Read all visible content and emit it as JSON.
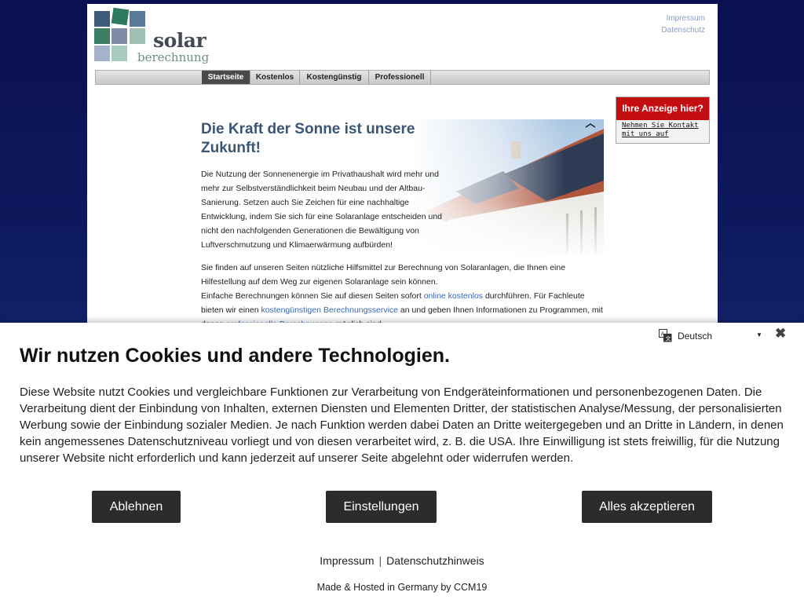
{
  "colors": {
    "nav_active": "#4a4a4a",
    "ad_red": "#c40d10",
    "headline": "#3b5674",
    "link": "#3a68b4",
    "button": "#2c2c2c"
  },
  "logo": {
    "word1": "solar",
    "word2": "berechnung"
  },
  "toplinks": [
    "Impressum",
    "Datenschutz"
  ],
  "nav": [
    "Startseite",
    "Kostenlos",
    "Kostengünstig",
    "Professionell"
  ],
  "ad": {
    "title": "Ihre Anzeige hier?",
    "link_line1": "Nehmen Sie Kontakt",
    "link_line2": "mit uns auf"
  },
  "content": {
    "headline": "Die Kraft der Sonne ist unsere Zukunft!",
    "para1": "Die Nutzung der Sonnenenergie im Privathaushalt wird mehr und mehr zur Selbstverständlichkeit beim Neubau und der Altbau-Sanierung. Setzen auch Sie Zeichen für eine nachhaltige Entwicklung, indem Sie sich für eine Solaranlage entscheiden und nicht den nachfolgenden Generationen die Bewältigung von Luftverschmutzung und Klimaerwärmung aufbürden!",
    "para2": "Sie finden auf unseren Seiten nützliche Hilfsmittel zur Berechnung von Solaranlagen, die Ihnen eine Hilfestellung auf dem Weg zur eigenen Solaranlage sein können.",
    "para3_a": "Einfache Berechnungen können Sie auf diesen Seiten sofort",
    "para3_link1": "online kostenlos",
    "para3_b": "durchführen. Für Fachleute bieten wir einen",
    "para3_link2": "kostengünstigen Berechnungsservice",
    "para3_c": "an und geben Ihnen Informationen zu Programmen, mit denen",
    "para3_link3": "professionelle Berechnungen",
    "para3_d": "möglich sind."
  },
  "cookie": {
    "language": "Deutsch",
    "title": "Wir nutzen Cookies und andere Technologien.",
    "text": "Diese Website nutzt Cookies und vergleichbare Funktionen zur Verarbeitung von Endgeräteinformationen und personenbezogenen Daten. Die Verarbeitung dient der Einbindung von Inhalten, externen Diensten und Elementen Dritter, der statistischen Analyse/Messung, der personalisierten Werbung sowie der Einbindung sozialer Medien. Je nach Funktion werden dabei Daten an Dritte weitergegeben und an Dritte in Ländern, in denen kein angemessenes Datenschutzniveau vorliegt und von diesen verarbeitet wird, z. B. die USA. Ihre Einwilligung ist stets freiwillig, für die Nutzung unserer Website nicht erforderlich und kann jederzeit auf unserer Seite abgelehnt oder widerrufen werden.",
    "btn_reject": "Ablehnen",
    "btn_settings": "Einstellungen",
    "btn_accept": "Alles akzeptieren",
    "link_impressum": "Impressum",
    "separator": "|",
    "link_privacy": "Datenschutzhinweis",
    "made": "Made & Hosted in Germany by CCM19"
  }
}
